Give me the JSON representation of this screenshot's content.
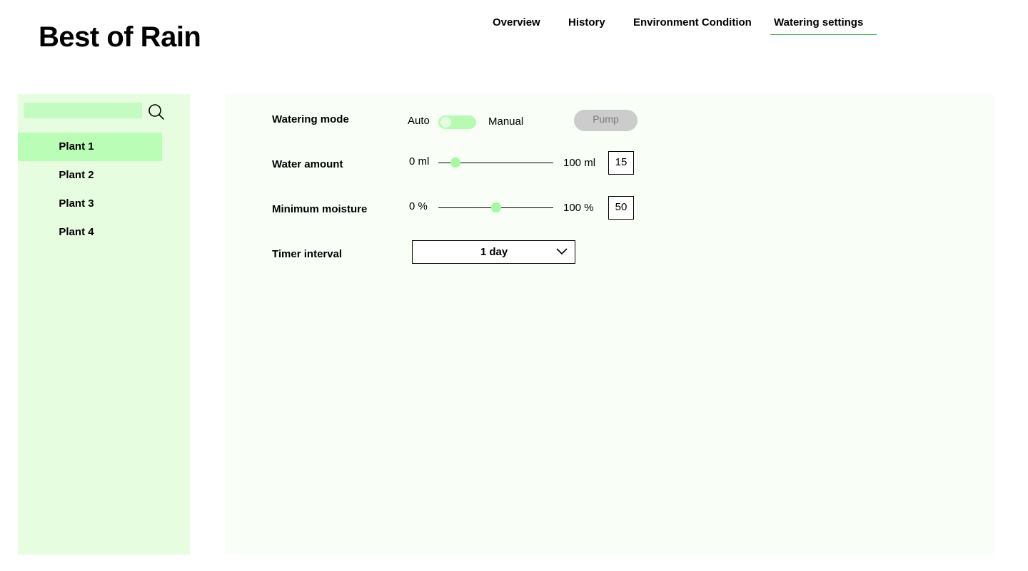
{
  "app": {
    "title": "Best of Rain"
  },
  "nav": {
    "items": [
      {
        "label": "Overview"
      },
      {
        "label": "History"
      },
      {
        "label": "Environment Condition"
      },
      {
        "label": "Watering settings",
        "active": true
      }
    ]
  },
  "sidebar": {
    "search": {
      "value": "",
      "placeholder": ""
    },
    "plants": [
      {
        "label": "Plant 1",
        "selected": true
      },
      {
        "label": "Plant 2"
      },
      {
        "label": "Plant 3"
      },
      {
        "label": "Plant 4"
      }
    ]
  },
  "settings": {
    "watering_mode": {
      "label": "Watering mode",
      "option_left": "Auto",
      "option_right": "Manual",
      "pump_label": "Pump",
      "pump_enabled": false
    },
    "water_amount": {
      "label": "Water amount",
      "min_label": "0 ml",
      "max_label": "100 ml",
      "min": 0,
      "max": 100,
      "value": "15"
    },
    "minimum_moisture": {
      "label": "Minimum moisture",
      "min_label": "0 %",
      "max_label": "100 %",
      "min": 0,
      "max": 100,
      "value": "50"
    },
    "timer_interval": {
      "label": "Timer interval",
      "selected": "1 day"
    }
  },
  "colors": {
    "accent": "#3fb84a",
    "sidebar_bg": "#e7fde0",
    "selected_bg": "#b9fdb6",
    "panel_bg": "#f9fef6",
    "slider_thumb": "#a6f8a2",
    "pump_disabled": "#cccccc"
  },
  "icons": {
    "search": "search-icon",
    "dropdown": "chevron-down-icon"
  }
}
